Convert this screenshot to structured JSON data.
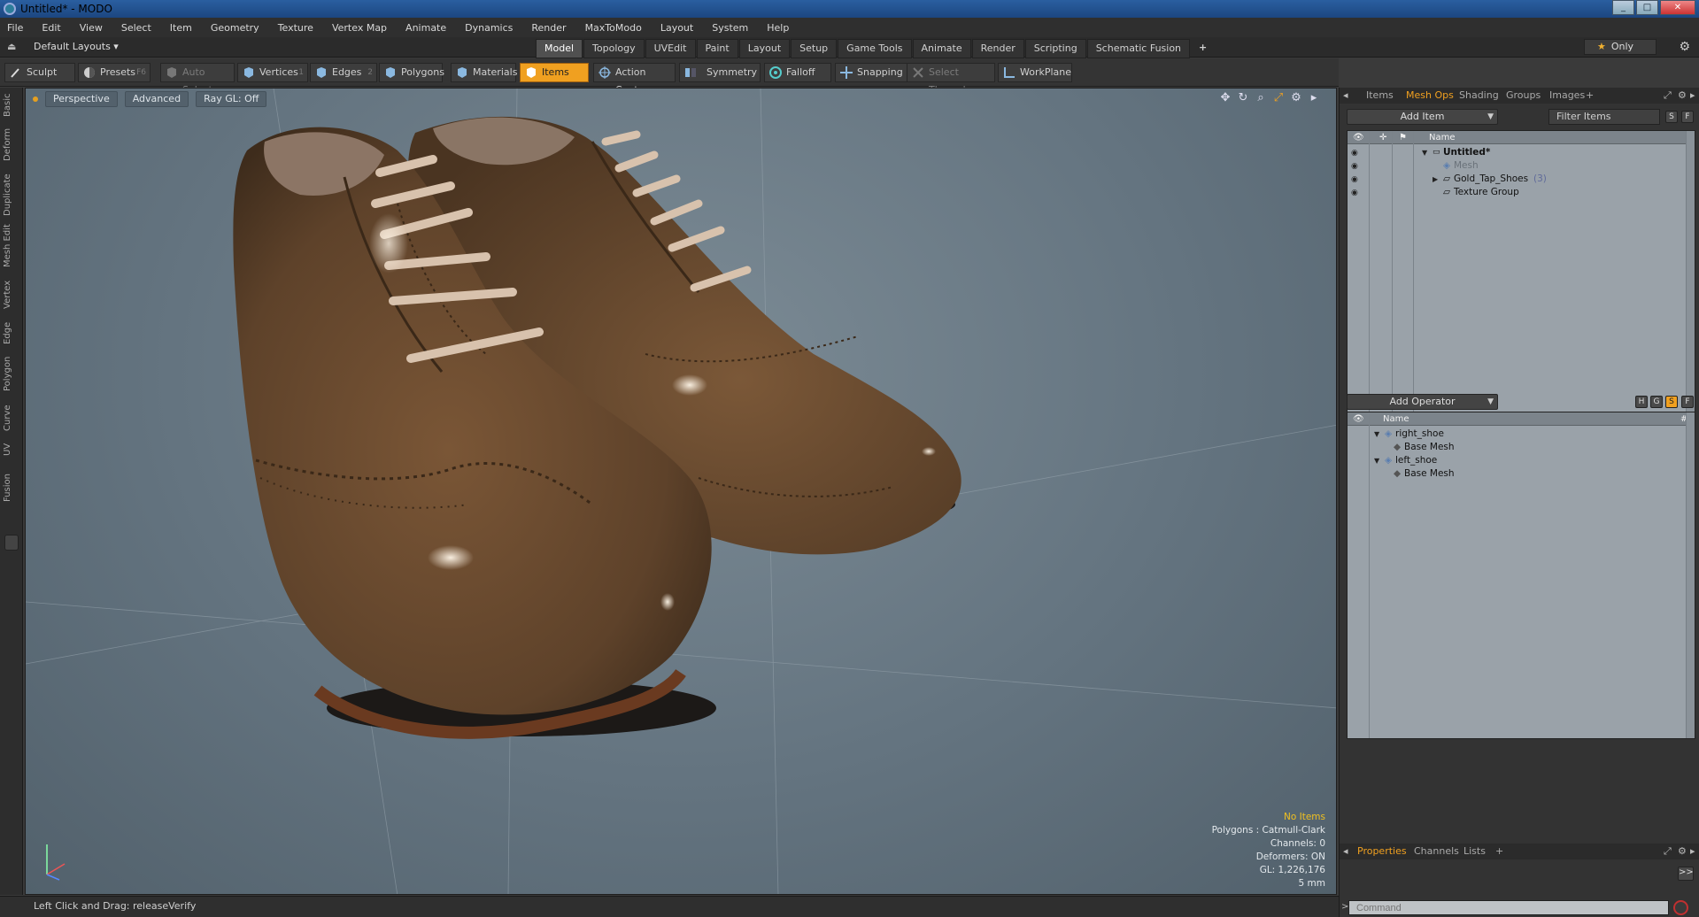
{
  "window": {
    "title": "Untitled* - MODO"
  },
  "menu": [
    "File",
    "Edit",
    "View",
    "Select",
    "Item",
    "Geometry",
    "Texture",
    "Vertex Map",
    "Animate",
    "Dynamics",
    "Render",
    "MaxToModo",
    "Layout",
    "System",
    "Help"
  ],
  "layout": {
    "name": "Default Layouts ▾",
    "tabs": [
      "Model",
      "Topology",
      "UVEdit",
      "Paint",
      "Layout",
      "Setup",
      "Game Tools",
      "Animate",
      "Render",
      "Scripting",
      "Schematic Fusion"
    ],
    "active_tab": "Model",
    "only_label": "Only"
  },
  "toolbar": {
    "sculpt": "Sculpt",
    "presets": "Presets",
    "presets_key": "F6",
    "auto_select": "Auto Select",
    "vertices": "Vertices",
    "vertices_key": "1",
    "edges": "Edges",
    "edges_key": "2",
    "polygons": "Polygons",
    "materials": "Materials",
    "items": "Items",
    "action_center": "Action Center",
    "symmetry": "Symmetry",
    "falloff": "Falloff",
    "snapping": "Snapping",
    "select_through": "Select Through",
    "workplane": "WorkPlane"
  },
  "side_tabs": [
    "Basic",
    "Deform",
    "Duplicate",
    "Mesh Edit",
    "Vertex",
    "Edge",
    "Polygon",
    "Curve",
    "UV",
    "Fusion"
  ],
  "viewport": {
    "view": "Perspective",
    "shading": "Advanced",
    "raygl": "Ray GL: Off",
    "info": {
      "no_items": "No Items",
      "polygons": "Polygons : Catmull-Clark",
      "channels": "Channels: 0",
      "deformers": "Deformers: ON",
      "gl": "GL: 1,226,176",
      "scale": "5 mm"
    }
  },
  "status": {
    "text": "Left Click and Drag:   releaseVerify"
  },
  "items_panel": {
    "tabs": [
      "Items",
      "Mesh Ops",
      "Shading",
      "Groups",
      "Images"
    ],
    "active_tab": "Mesh Ops",
    "add_item": "Add Item",
    "filter": "Filter Items",
    "s_btn": "S",
    "f_btn": "F",
    "header": "Name",
    "rows": [
      {
        "label": "Untitled*",
        "bold": true
      },
      {
        "label": "Mesh",
        "dim": true
      },
      {
        "label": "Gold_Tap_Shoes",
        "suffix": "(3)"
      },
      {
        "label": "Texture Group"
      }
    ]
  },
  "meshops_panel": {
    "add_operator": "Add Operator",
    "h_btn": "H",
    "g_btn": "G",
    "s_btn": "S",
    "f_btn": "F",
    "header": "Name",
    "hash": "#",
    "rows": [
      {
        "label": "right_shoe"
      },
      {
        "label": "Base Mesh"
      },
      {
        "label": "left_shoe"
      },
      {
        "label": "Base Mesh"
      }
    ]
  },
  "properties_panel": {
    "tabs": [
      "Properties",
      "Channels",
      "Lists"
    ],
    "active_tab": "Properties",
    "expand": ">>"
  },
  "command": {
    "placeholder": "Command"
  },
  "colors": {
    "accent": "#f0a020",
    "viewport_bg": "#6d7c86",
    "leather": "#6b4a30"
  }
}
